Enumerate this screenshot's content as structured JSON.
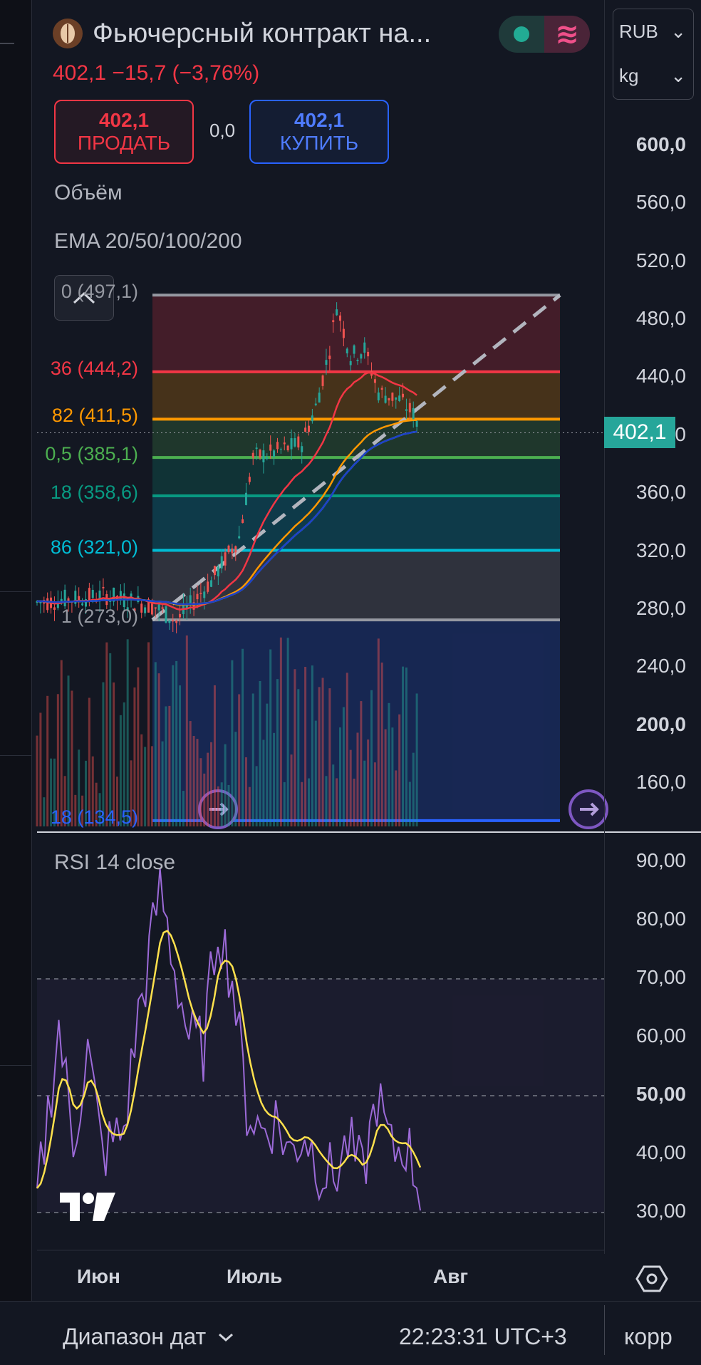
{
  "header": {
    "title": "Фьючерсный контракт на...",
    "price_change": "402,1  −15,7 (−3,76%)",
    "sell": {
      "value": "402,1",
      "label": "ПРОДАТЬ"
    },
    "buy": {
      "value": "402,1",
      "label": "КУПИТЬ"
    },
    "spread": "0,0",
    "currency": "RUB",
    "unit": "kg"
  },
  "indicators": {
    "volume_label": "Объём",
    "ema_label": "EMA 20/50/100/200",
    "rsi_label": "RSI 14 close"
  },
  "price_axis": [
    "600,0",
    "560,0",
    "520,0",
    "480,0",
    "440,0",
    "400,0",
    "360,0",
    "320,0",
    "280,0",
    "240,0",
    "200,0",
    "160,0"
  ],
  "last_price": "402,1",
  "fib_levels": [
    {
      "label": "0 (497,1)",
      "value": 497.1,
      "color": "#9598a1"
    },
    {
      "label": "36 (444,2)",
      "value": 444.2,
      "color": "#f23645"
    },
    {
      "label": "82 (411,5)",
      "value": 411.5,
      "color": "#ff9800"
    },
    {
      "label": "0,5 (385,1)",
      "value": 385.1,
      "color": "#4caf50"
    },
    {
      "label": "18 (358,6)",
      "value": 358.6,
      "color": "#089981"
    },
    {
      "label": "86 (321,0)",
      "value": 321.0,
      "color": "#00bcd4"
    },
    {
      "label": "1 (273,0)",
      "value": 273.0,
      "color": "#9598a1"
    },
    {
      "label": "18 (134,5)",
      "value": 134.5,
      "color": "#2962ff"
    }
  ],
  "rsi_axis": [
    "90,00",
    "80,00",
    "70,00",
    "60,00",
    "50,00",
    "40,00",
    "30,00"
  ],
  "time_axis": [
    "Июн",
    "Июль",
    "Авг"
  ],
  "bottom": {
    "range_label": "Диапазон дат",
    "clock": "22:23:31 UTC+3",
    "corr": "корр"
  }
}
